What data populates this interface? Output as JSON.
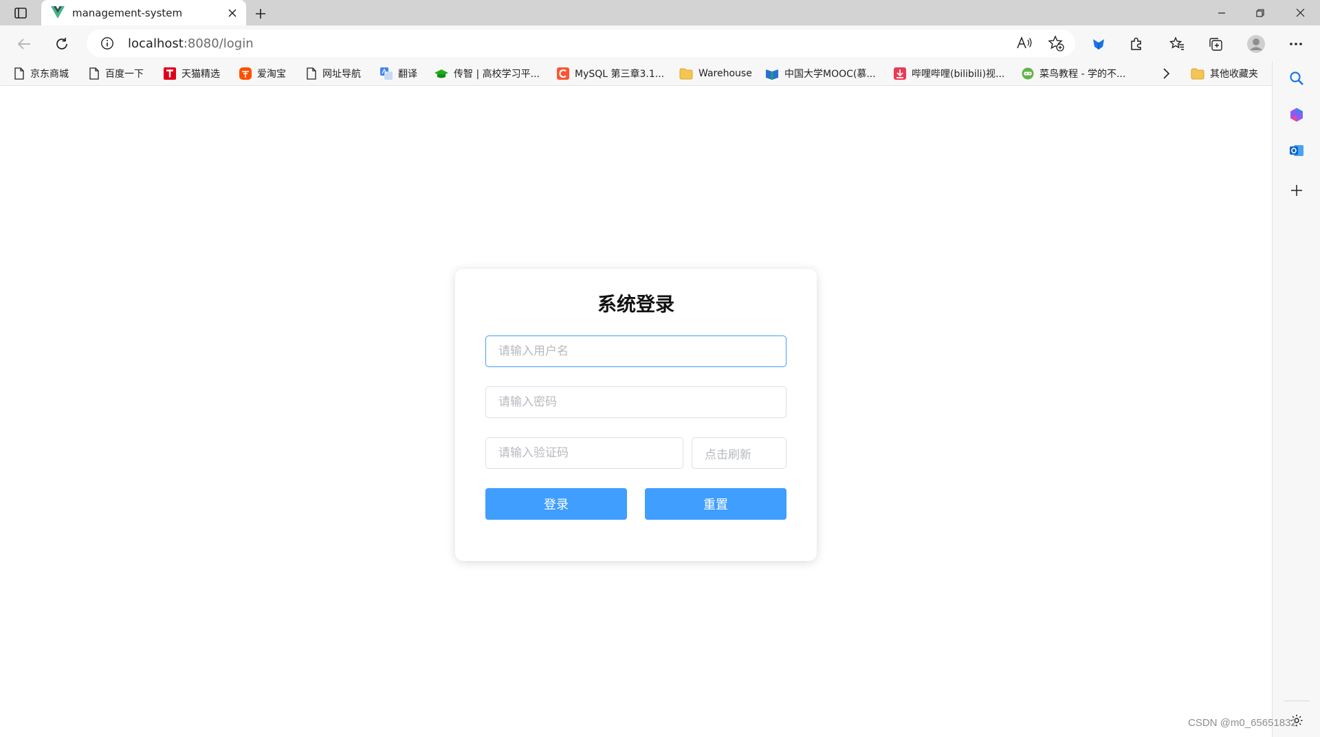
{
  "browser": {
    "tab_title": "management-system",
    "address": {
      "host": "localhost",
      "rest": ":8080/login"
    }
  },
  "bookmarks": [
    {
      "label": "京东商城",
      "icon": "page-icon"
    },
    {
      "label": "百度一下",
      "icon": "page-icon"
    },
    {
      "label": "天猫精选",
      "icon": "tmall-icon"
    },
    {
      "label": "爱淘宝",
      "icon": "taobao-icon"
    },
    {
      "label": "网址导航",
      "icon": "page-icon"
    },
    {
      "label": "翻译",
      "icon": "translate-icon"
    },
    {
      "label": "传智 | 高校学习平...",
      "icon": "graduation-cap-icon"
    },
    {
      "label": "MySQL 第三章3.1...",
      "icon": "csdn-icon"
    },
    {
      "label": "Warehouse",
      "icon": "folder-icon"
    },
    {
      "label": "中国大学MOOC(慕...",
      "icon": "mooc-icon"
    },
    {
      "label": "哔哩哔哩(bilibili)视...",
      "icon": "bilibili-icon"
    },
    {
      "label": "菜鸟教程 - 学的不...",
      "icon": "runoob-icon"
    },
    {
      "label": "其他收藏夹",
      "icon": "folder-icon"
    }
  ],
  "login": {
    "title": "系统登录",
    "username_placeholder": "请输入用户名",
    "password_placeholder": "请输入密码",
    "captcha_placeholder": "请输入验证码",
    "captcha_refresh": "点击刷新",
    "login_button": "登录",
    "reset_button": "重置"
  },
  "watermark": "CSDN @m0_65651832",
  "colors": {
    "primary": "#409eff",
    "field_border": "#dcdfe6",
    "placeholder": "#b6b9bf",
    "tab_strip": "#d3d3d3",
    "toolbar": "#f7f7f7"
  }
}
